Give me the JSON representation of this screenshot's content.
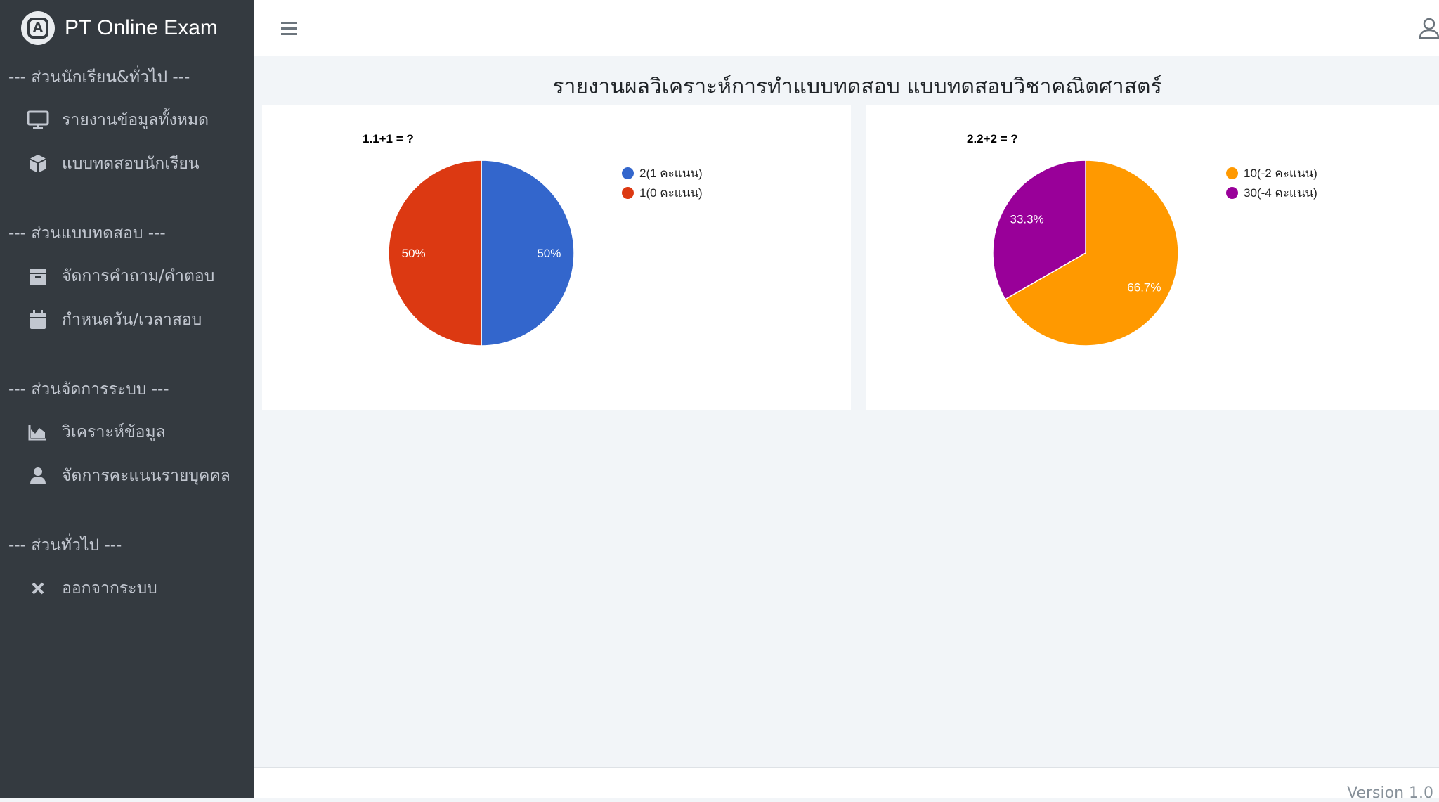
{
  "brand": {
    "name": "PT Online Exam"
  },
  "sidebar": {
    "sections": [
      {
        "header": "--- ส่วนนักเรียน&ทั่วไป ---",
        "items": [
          {
            "label": "รายงานข้อมูลทั้งหมด",
            "icon": "monitor-icon"
          },
          {
            "label": "แบบทดสอบนักเรียน",
            "icon": "cube-icon"
          }
        ]
      },
      {
        "header": "--- ส่วนแบบทดสอบ ---",
        "items": [
          {
            "label": "จัดการคำถาม/คำตอบ",
            "icon": "archive-icon"
          },
          {
            "label": "กำหนดวัน/เวลาสอบ",
            "icon": "calendar-icon"
          }
        ]
      },
      {
        "header": "--- ส่วนจัดการระบบ ---",
        "items": [
          {
            "label": "วิเคราะห์ข้อมูล",
            "icon": "area-chart-icon"
          },
          {
            "label": "จัดการคะแนนรายบุคคล",
            "icon": "user-icon"
          }
        ]
      },
      {
        "header": "--- ส่วนทั่วไป ---",
        "items": [
          {
            "label": "ออกจากระบบ",
            "icon": "close-icon"
          }
        ]
      }
    ]
  },
  "page": {
    "title": "รายงานผลวิเคราะห์การทำแบบทดสอบ แบบทดสอบวิชาคณิตศาสตร์"
  },
  "chart_data": [
    {
      "type": "pie",
      "title": "1.1+1 = ?",
      "categories": [
        "2(1 คะแนน)",
        "1(0 คะแนน)"
      ],
      "values": [
        50,
        50
      ],
      "labels": [
        "50%",
        "50%"
      ],
      "colors": [
        "#3366cc",
        "#dc3912"
      ],
      "legend": "right"
    },
    {
      "type": "pie",
      "title": "2.2+2 = ?",
      "categories": [
        "10(-2 คะแนน)",
        "30(-4 คะแนน)"
      ],
      "values": [
        66.7,
        33.3
      ],
      "labels": [
        "66.7%",
        "33.3%"
      ],
      "colors": [
        "#ff9900",
        "#990099"
      ],
      "legend": "right"
    }
  ],
  "footer": {
    "version": "Version 1.0"
  }
}
